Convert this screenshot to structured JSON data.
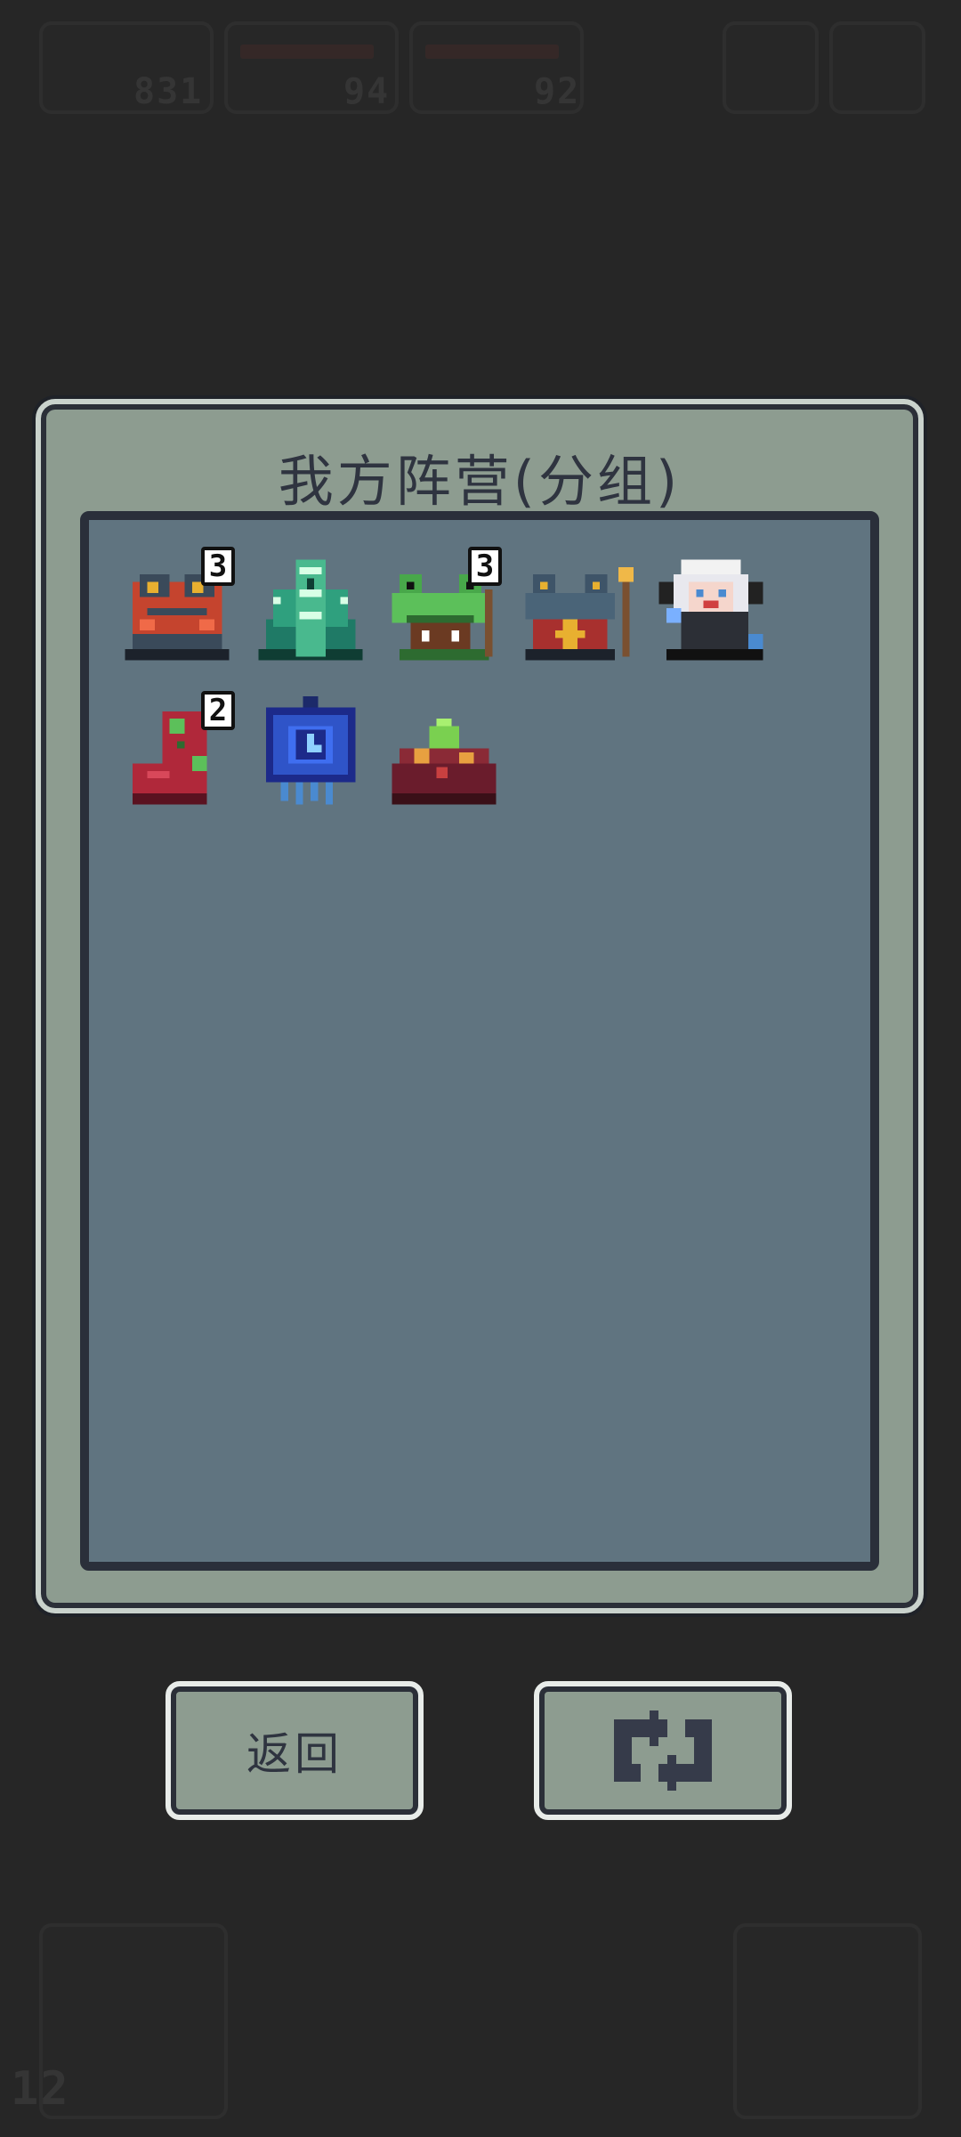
{
  "background_hud": {
    "stat_1": "831",
    "stat_2": "94",
    "stat_3": "92",
    "level": "12"
  },
  "panel": {
    "title": "我方阵营(分组)"
  },
  "units": [
    {
      "name": "red-toad",
      "level": "3",
      "icon": "red-toad-icon"
    },
    {
      "name": "green-cactus-snake",
      "level": "",
      "icon": "cactus-snake-icon"
    },
    {
      "name": "green-frog-warrior",
      "level": "3",
      "icon": "green-frog-icon"
    },
    {
      "name": "blue-frog-mage",
      "level": "",
      "icon": "frog-mage-icon"
    },
    {
      "name": "white-haired-witch",
      "level": "",
      "icon": "witch-icon"
    },
    {
      "name": "red-sock-creature",
      "level": "2",
      "icon": "red-sock-icon"
    },
    {
      "name": "blue-clock-lantern",
      "level": "",
      "icon": "clock-lantern-icon"
    },
    {
      "name": "slime-mound",
      "level": "",
      "icon": "slime-mound-icon"
    }
  ],
  "buttons": {
    "back_label": "返回",
    "refresh_icon": "refresh-icon"
  },
  "colors": {
    "panel": "#8d9c90",
    "panel_inner": "#607480",
    "border_dark": "#2a2f3a",
    "text_dark": "#2f3440"
  }
}
